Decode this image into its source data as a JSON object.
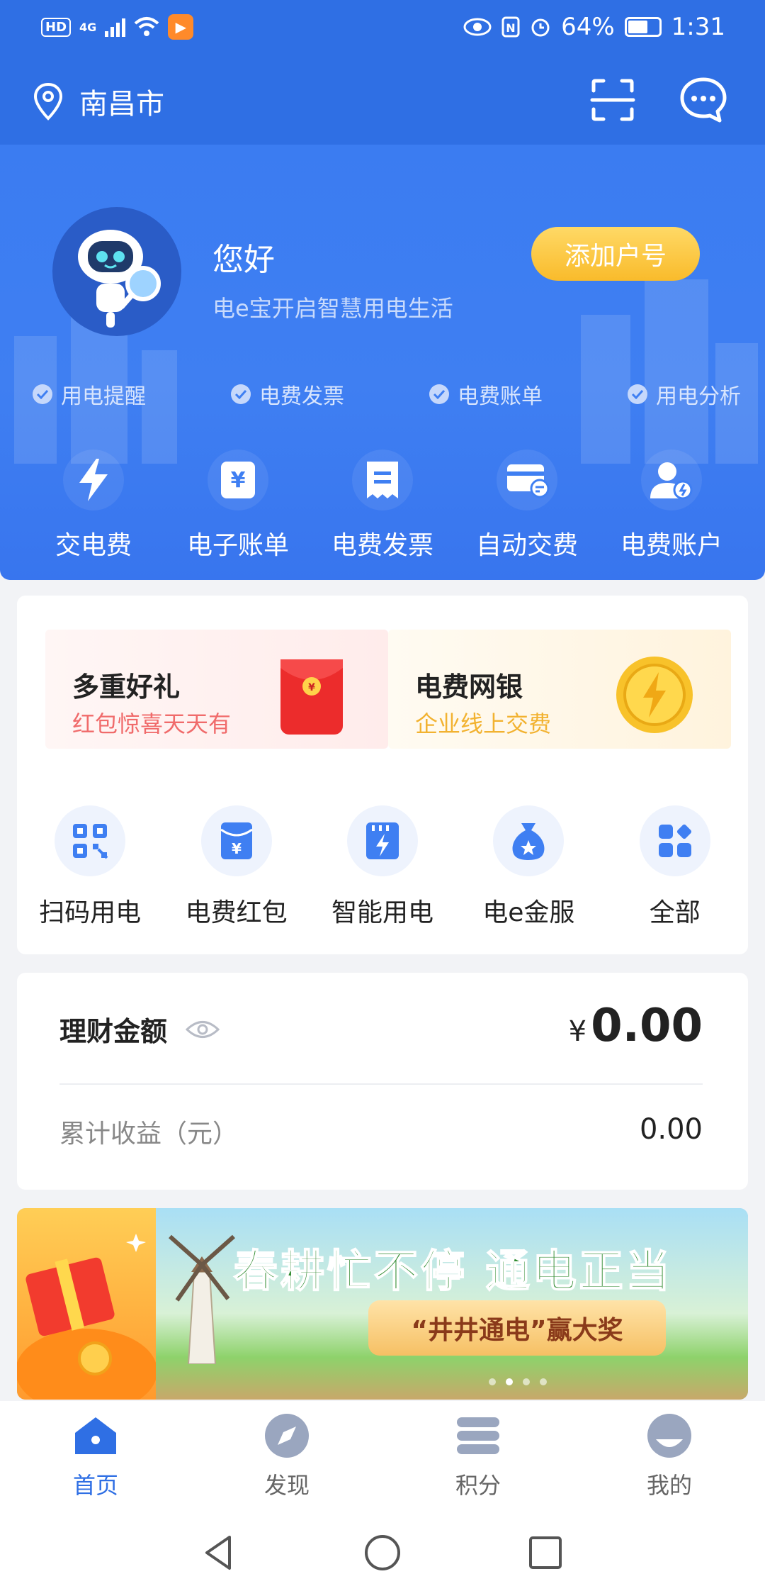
{
  "status_bar": {
    "hd": "HD",
    "network": "4G",
    "battery": "64%",
    "battery_level": 0.64,
    "time": "1:31"
  },
  "header": {
    "city": "南昌市",
    "icons": [
      "location-icon",
      "scan-icon",
      "message-icon"
    ]
  },
  "hero": {
    "greeting": "您好",
    "slogan": "电e宝开启智慧用电生活",
    "add_account": "添加户号",
    "features": [
      "用电提醒",
      "电费发票",
      "电费账单",
      "用电分析"
    ],
    "quick_actions": [
      {
        "label": "交电费",
        "icon": "lightning-icon"
      },
      {
        "label": "电子账单",
        "icon": "bill-icon"
      },
      {
        "label": "电费发票",
        "icon": "invoice-icon"
      },
      {
        "label": "自动交费",
        "icon": "card-icon"
      },
      {
        "label": "电费账户",
        "icon": "user-account-icon"
      }
    ]
  },
  "promos": [
    {
      "title": "多重好礼",
      "subtitle": "红包惊喜天天有",
      "icon": "red-envelope-icon"
    },
    {
      "title": "电费网银",
      "subtitle": "企业线上交费",
      "icon": "gold-coin-icon"
    }
  ],
  "services": [
    {
      "label": "扫码用电",
      "icon": "qr-code-icon"
    },
    {
      "label": "电费红包",
      "icon": "red-packet-icon"
    },
    {
      "label": "智能用电",
      "icon": "smart-power-icon"
    },
    {
      "label": "电e金服",
      "icon": "money-bag-icon"
    },
    {
      "label": "全部",
      "icon": "grid-icon"
    }
  ],
  "finance": {
    "title": "理财金额",
    "currency": "¥",
    "amount": "0.00",
    "cumulative_label": "累计收益（元）",
    "cumulative_value": "0.00"
  },
  "banner": {
    "title": "春耕忙不停 通电正当",
    "pill": "“井井通电”赢大奖",
    "dots": 4,
    "active_dot": 1
  },
  "tabs": [
    {
      "label": "首页",
      "icon": "home-icon",
      "active": true
    },
    {
      "label": "发现",
      "icon": "compass-icon",
      "active": false
    },
    {
      "label": "积分",
      "icon": "points-icon",
      "active": false
    },
    {
      "label": "我的",
      "icon": "profile-icon",
      "active": false
    }
  ],
  "colors": {
    "primary": "#2f6fe4",
    "accent_yellow": "#f9bb2b",
    "promo_red": "#f06b6b",
    "promo_gold": "#f2b230"
  }
}
